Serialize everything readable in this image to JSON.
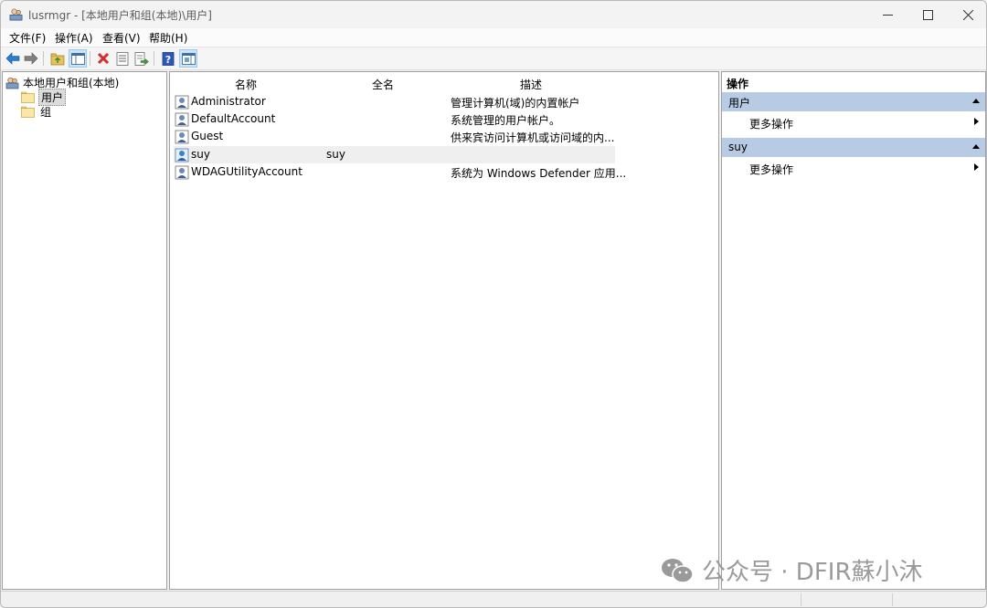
{
  "window": {
    "title": "lusrmgr - [本地用户和组(本地)\\用户]"
  },
  "menu": {
    "items": [
      "文件(F)",
      "操作(A)",
      "查看(V)",
      "帮助(H)"
    ]
  },
  "toolbar": {
    "icons": [
      "back-arrow-icon",
      "forward-arrow-icon",
      "up-folder-icon",
      "show-hide-tree-icon",
      "delete-icon",
      "properties-icon",
      "export-list-icon",
      "help-icon",
      "show-hide-action-pane-icon"
    ]
  },
  "tree": {
    "root": "本地用户和组(本地)",
    "children": [
      "用户",
      "组"
    ],
    "selected": "用户"
  },
  "list": {
    "columns": [
      "名称",
      "全名",
      "描述"
    ],
    "rows": [
      {
        "name": "Administrator",
        "fullname": "",
        "description": "管理计算机(域)的内置帐户"
      },
      {
        "name": "DefaultAccount",
        "fullname": "",
        "description": "系统管理的用户帐户。"
      },
      {
        "name": "Guest",
        "fullname": "",
        "description": "供来宾访问计算机或访问域的内..."
      },
      {
        "name": "suy",
        "fullname": "suy",
        "description": ""
      },
      {
        "name": "WDAGUtilityAccount",
        "fullname": "",
        "description": "系统为 Windows Defender 应用..."
      }
    ]
  },
  "actions": {
    "title": "操作",
    "groups": [
      {
        "label": "用户",
        "items": [
          "更多操作"
        ]
      },
      {
        "label": "suy",
        "items": [
          "更多操作"
        ]
      }
    ]
  },
  "watermark": {
    "text": "公众号 · DFIR蘇小沐"
  },
  "colors": {
    "action_group_bg": "#b8cbe4",
    "selection_bg": "#dcdcdc",
    "delete_red": "#d92b2b",
    "arrow_blue": "#2b7cd3"
  }
}
